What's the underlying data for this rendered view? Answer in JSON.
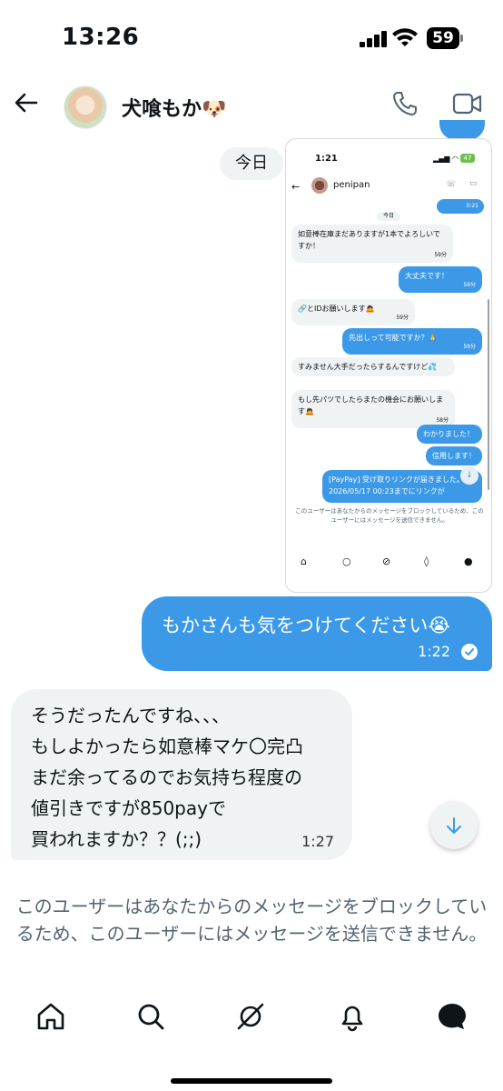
{
  "status_bar": {
    "time": "13:26",
    "battery": "59"
  },
  "header": {
    "contact_name": "犬喰もか🐶",
    "back_icon": "arrow-left-icon",
    "call_icon": "phone-icon",
    "video_icon": "video-camera-icon"
  },
  "chat": {
    "date_label": "今日",
    "embedded_screenshot": {
      "status_time": "1:21",
      "battery": "47",
      "contact_name": "penipan",
      "top_time": "0:21",
      "date_label": "今日",
      "messages": [
        {
          "dir": "in",
          "text": "如意棒在庫まだありますが1本でよろしいですか！",
          "time": "59分"
        },
        {
          "dir": "out",
          "text": "大丈夫です！",
          "time": "59分"
        },
        {
          "dir": "in",
          "text": "🔗とIDお願いします🙇",
          "time": "59分"
        },
        {
          "dir": "out",
          "text": "先出しって可能ですか？🙏",
          "time": "59分"
        },
        {
          "dir": "in",
          "text": "すみません大手だったらするんですけど💦",
          "time": ""
        },
        {
          "dir": "in",
          "text": "もし先パツでしたらまたの機会にお願いします🙇",
          "time": "58分"
        },
        {
          "dir": "out",
          "text": "わかりました！",
          "time": ""
        },
        {
          "dir": "out",
          "text": "信用します！",
          "time": ""
        },
        {
          "dir": "out",
          "text": "[PayPay] 受け取りリンクが届きました。2026/05/17 00:23までにリンクが",
          "time": ""
        }
      ],
      "blocked_notice": "このユーザーはあなたからのメッセージをブロックしているため、このユーザーにはメッセージを送信できません。"
    },
    "messages": [
      {
        "dir": "out",
        "text": "もかさんも気をつけてください😭",
        "time": "1:22"
      },
      {
        "dir": "in",
        "lines": [
          "そうだったんですね、、、",
          "もしよかったら如意棒マケ〇完凸",
          "まだ余ってるのでお気持ち程度の",
          "値引きですが850payで",
          "買われますか？？(;;)"
        ],
        "time": "1:27"
      }
    ]
  },
  "blocked_notice": "このユーザーはあなたからのメッセージをブロックしているため、このユーザーにはメッセージを送信できません。",
  "bottom_nav": {
    "items": [
      "home-icon",
      "search-icon",
      "grok-icon",
      "notifications-icon",
      "messages-icon"
    ]
  }
}
